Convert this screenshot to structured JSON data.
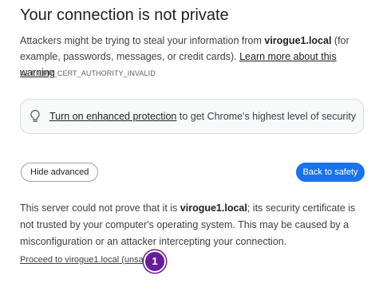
{
  "page": {
    "title": "Your connection is not private",
    "intro_before": "Attackers might be trying to steal your information from ",
    "intro_host": "virogue1.local",
    "intro_after": " (for example, passwords, messages, or credit cards). ",
    "learn_more_link": "Learn more about this warning",
    "error_code": "NET::ERR_CERT_AUTHORITY_INVALID"
  },
  "enhanced_protection": {
    "icon": "lightbulb-icon",
    "link": "Turn on enhanced protection",
    "text_after": " to get Chrome's highest level of security"
  },
  "buttons": {
    "hide_advanced": "Hide advanced",
    "back_to_safety": "Back to safety"
  },
  "details": {
    "before": "This server could not prove that it is ",
    "host": "virogue1.local",
    "after": "; its security certificate is not trusted by your computer's operating system. This may be caused by a misconfiguration or an attacker intercepting your connection."
  },
  "proceed": {
    "link": "Proceed to virogue1.local (unsafe)"
  },
  "annotation": {
    "step_number": "1"
  },
  "colors": {
    "primary_button": "#1a73e8",
    "badge": "#6a1b9a"
  }
}
